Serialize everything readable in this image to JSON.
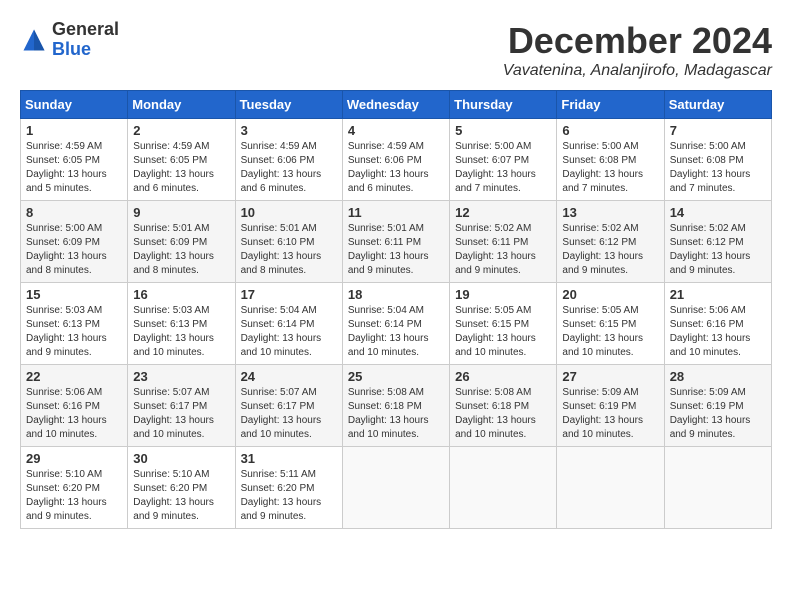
{
  "header": {
    "logo_general": "General",
    "logo_blue": "Blue",
    "month_title": "December 2024",
    "location": "Vavatenina, Analanjirofo, Madagascar"
  },
  "calendar": {
    "days_of_week": [
      "Sunday",
      "Monday",
      "Tuesday",
      "Wednesday",
      "Thursday",
      "Friday",
      "Saturday"
    ],
    "weeks": [
      [
        null,
        {
          "day": "2",
          "line1": "Sunrise: 4:59 AM",
          "line2": "Sunset: 6:05 PM",
          "line3": "Daylight: 13 hours",
          "line4": "and 6 minutes."
        },
        {
          "day": "3",
          "line1": "Sunrise: 4:59 AM",
          "line2": "Sunset: 6:06 PM",
          "line3": "Daylight: 13 hours",
          "line4": "and 6 minutes."
        },
        {
          "day": "4",
          "line1": "Sunrise: 4:59 AM",
          "line2": "Sunset: 6:06 PM",
          "line3": "Daylight: 13 hours",
          "line4": "and 6 minutes."
        },
        {
          "day": "5",
          "line1": "Sunrise: 5:00 AM",
          "line2": "Sunset: 6:07 PM",
          "line3": "Daylight: 13 hours",
          "line4": "and 7 minutes."
        },
        {
          "day": "6",
          "line1": "Sunrise: 5:00 AM",
          "line2": "Sunset: 6:08 PM",
          "line3": "Daylight: 13 hours",
          "line4": "and 7 minutes."
        },
        {
          "day": "7",
          "line1": "Sunrise: 5:00 AM",
          "line2": "Sunset: 6:08 PM",
          "line3": "Daylight: 13 hours",
          "line4": "and 7 minutes."
        }
      ],
      [
        {
          "day": "1",
          "line1": "Sunrise: 4:59 AM",
          "line2": "Sunset: 6:05 PM",
          "line3": "Daylight: 13 hours",
          "line4": "and 5 minutes."
        },
        {
          "day": "9",
          "line1": "Sunrise: 5:01 AM",
          "line2": "Sunset: 6:09 PM",
          "line3": "Daylight: 13 hours",
          "line4": "and 8 minutes."
        },
        {
          "day": "10",
          "line1": "Sunrise: 5:01 AM",
          "line2": "Sunset: 6:10 PM",
          "line3": "Daylight: 13 hours",
          "line4": "and 8 minutes."
        },
        {
          "day": "11",
          "line1": "Sunrise: 5:01 AM",
          "line2": "Sunset: 6:11 PM",
          "line3": "Daylight: 13 hours",
          "line4": "and 9 minutes."
        },
        {
          "day": "12",
          "line1": "Sunrise: 5:02 AM",
          "line2": "Sunset: 6:11 PM",
          "line3": "Daylight: 13 hours",
          "line4": "and 9 minutes."
        },
        {
          "day": "13",
          "line1": "Sunrise: 5:02 AM",
          "line2": "Sunset: 6:12 PM",
          "line3": "Daylight: 13 hours",
          "line4": "and 9 minutes."
        },
        {
          "day": "14",
          "line1": "Sunrise: 5:02 AM",
          "line2": "Sunset: 6:12 PM",
          "line3": "Daylight: 13 hours",
          "line4": "and 9 minutes."
        }
      ],
      [
        {
          "day": "8",
          "line1": "Sunrise: 5:00 AM",
          "line2": "Sunset: 6:09 PM",
          "line3": "Daylight: 13 hours",
          "line4": "and 8 minutes."
        },
        {
          "day": "16",
          "line1": "Sunrise: 5:03 AM",
          "line2": "Sunset: 6:13 PM",
          "line3": "Daylight: 13 hours",
          "line4": "and 10 minutes."
        },
        {
          "day": "17",
          "line1": "Sunrise: 5:04 AM",
          "line2": "Sunset: 6:14 PM",
          "line3": "Daylight: 13 hours",
          "line4": "and 10 minutes."
        },
        {
          "day": "18",
          "line1": "Sunrise: 5:04 AM",
          "line2": "Sunset: 6:14 PM",
          "line3": "Daylight: 13 hours",
          "line4": "and 10 minutes."
        },
        {
          "day": "19",
          "line1": "Sunrise: 5:05 AM",
          "line2": "Sunset: 6:15 PM",
          "line3": "Daylight: 13 hours",
          "line4": "and 10 minutes."
        },
        {
          "day": "20",
          "line1": "Sunrise: 5:05 AM",
          "line2": "Sunset: 6:15 PM",
          "line3": "Daylight: 13 hours",
          "line4": "and 10 minutes."
        },
        {
          "day": "21",
          "line1": "Sunrise: 5:06 AM",
          "line2": "Sunset: 6:16 PM",
          "line3": "Daylight: 13 hours",
          "line4": "and 10 minutes."
        }
      ],
      [
        {
          "day": "15",
          "line1": "Sunrise: 5:03 AM",
          "line2": "Sunset: 6:13 PM",
          "line3": "Daylight: 13 hours",
          "line4": "and 9 minutes."
        },
        {
          "day": "23",
          "line1": "Sunrise: 5:07 AM",
          "line2": "Sunset: 6:17 PM",
          "line3": "Daylight: 13 hours",
          "line4": "and 10 minutes."
        },
        {
          "day": "24",
          "line1": "Sunrise: 5:07 AM",
          "line2": "Sunset: 6:17 PM",
          "line3": "Daylight: 13 hours",
          "line4": "and 10 minutes."
        },
        {
          "day": "25",
          "line1": "Sunrise: 5:08 AM",
          "line2": "Sunset: 6:18 PM",
          "line3": "Daylight: 13 hours",
          "line4": "and 10 minutes."
        },
        {
          "day": "26",
          "line1": "Sunrise: 5:08 AM",
          "line2": "Sunset: 6:18 PM",
          "line3": "Daylight: 13 hours",
          "line4": "and 10 minutes."
        },
        {
          "day": "27",
          "line1": "Sunrise: 5:09 AM",
          "line2": "Sunset: 6:19 PM",
          "line3": "Daylight: 13 hours",
          "line4": "and 10 minutes."
        },
        {
          "day": "28",
          "line1": "Sunrise: 5:09 AM",
          "line2": "Sunset: 6:19 PM",
          "line3": "Daylight: 13 hours",
          "line4": "and 9 minutes."
        }
      ],
      [
        {
          "day": "22",
          "line1": "Sunrise: 5:06 AM",
          "line2": "Sunset: 6:16 PM",
          "line3": "Daylight: 13 hours",
          "line4": "and 10 minutes."
        },
        {
          "day": "30",
          "line1": "Sunrise: 5:10 AM",
          "line2": "Sunset: 6:20 PM",
          "line3": "Daylight: 13 hours",
          "line4": "and 9 minutes."
        },
        {
          "day": "31",
          "line1": "Sunrise: 5:11 AM",
          "line2": "Sunset: 6:20 PM",
          "line3": "Daylight: 13 hours",
          "line4": "and 9 minutes."
        },
        null,
        null,
        null,
        null
      ],
      [
        {
          "day": "29",
          "line1": "Sunrise: 5:10 AM",
          "line2": "Sunset: 6:20 PM",
          "line3": "Daylight: 13 hours",
          "line4": "and 9 minutes."
        },
        null,
        null,
        null,
        null,
        null,
        null
      ]
    ]
  }
}
